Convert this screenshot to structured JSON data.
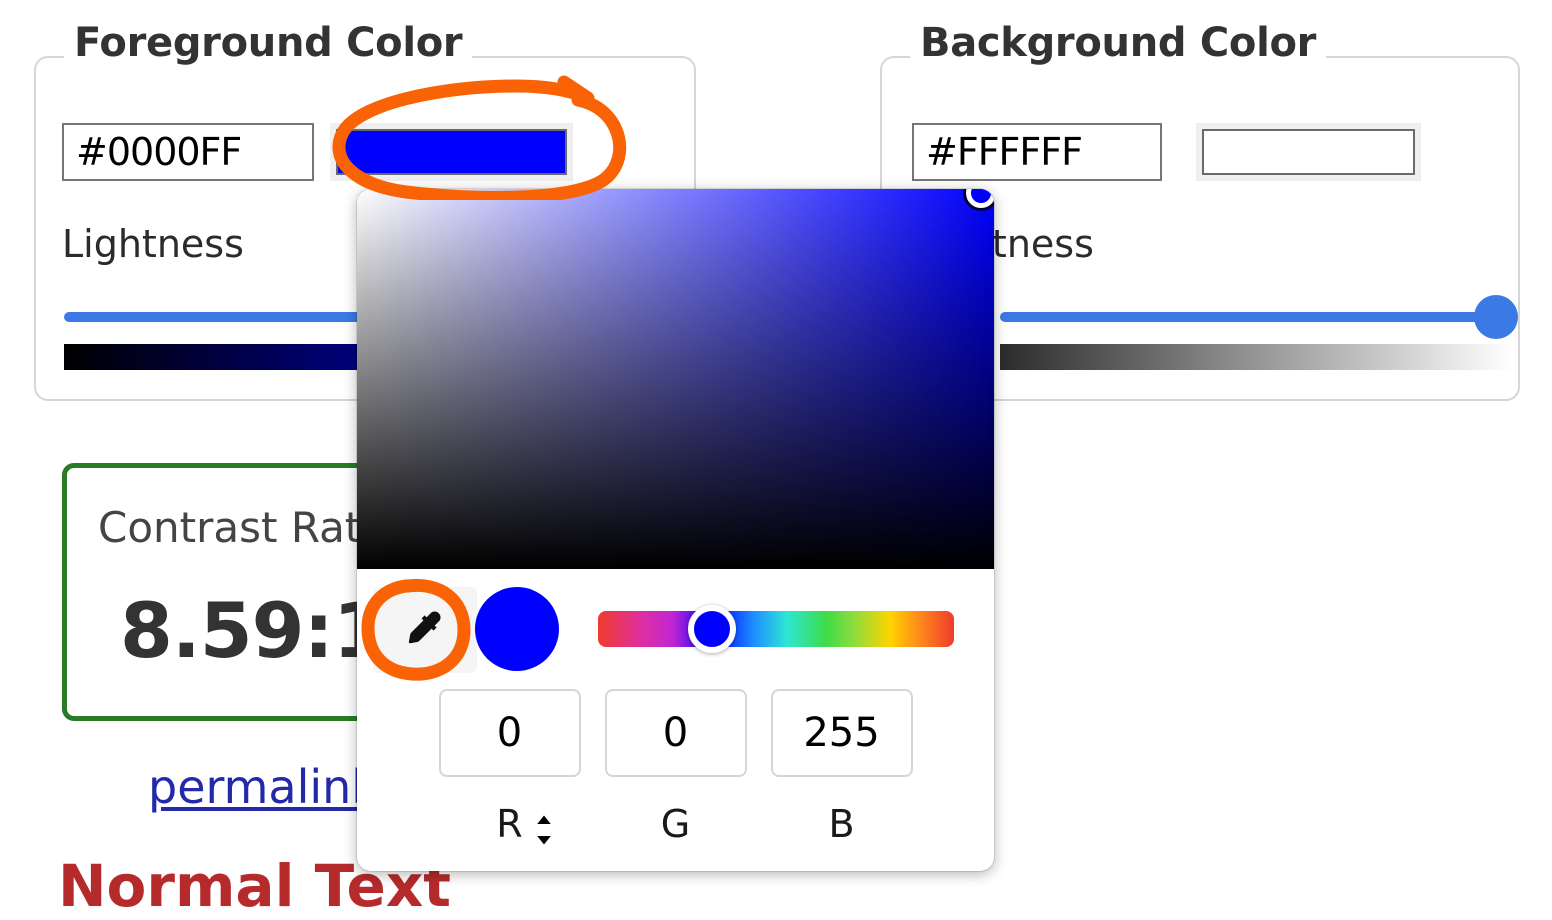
{
  "foreground": {
    "legend": "Foreground Color",
    "hex_value": "#0000FF",
    "hex_placeholder": "#000000",
    "swatch_color": "#0000FF",
    "lightness_label": "Lightness",
    "lightness_value": 100,
    "gradient_from": "#000000",
    "gradient_to": "#0000FF"
  },
  "background": {
    "legend": "Background Color",
    "hex_value": "#FFFFFF",
    "hex_placeholder": "#FFFFFF",
    "swatch_color": "#FFFFFF",
    "lightness_label": "Lightness",
    "lightness_value": 100,
    "gradient_from": "#000000",
    "gradient_to": "#FFFFFF"
  },
  "result": {
    "title": "Contrast Ratio",
    "value": "8.59:1",
    "permalink_label": "permalink",
    "sample_label": "Normal Text",
    "pass_border_color": "#2a7a28",
    "sample_color": "#b52a2a",
    "permalink_color": "#2329a8"
  },
  "picker": {
    "eyedropper_icon": "eyedropper-icon",
    "preview_color": "#0000FF",
    "hue_position_pct": 32,
    "sv_handle_x_pct": 98,
    "sv_handle_y_pct": 1,
    "channels": [
      {
        "label": "R",
        "value": "0"
      },
      {
        "label": "G",
        "value": "0"
      },
      {
        "label": "B",
        "value": "255"
      }
    ],
    "format_toggle_icon": "chevron-up-down-icon"
  },
  "annotations": {
    "accent_color": "#f96306",
    "marks": [
      {
        "name": "foreground-swatch-circle"
      },
      {
        "name": "eyedropper-circle"
      }
    ]
  }
}
